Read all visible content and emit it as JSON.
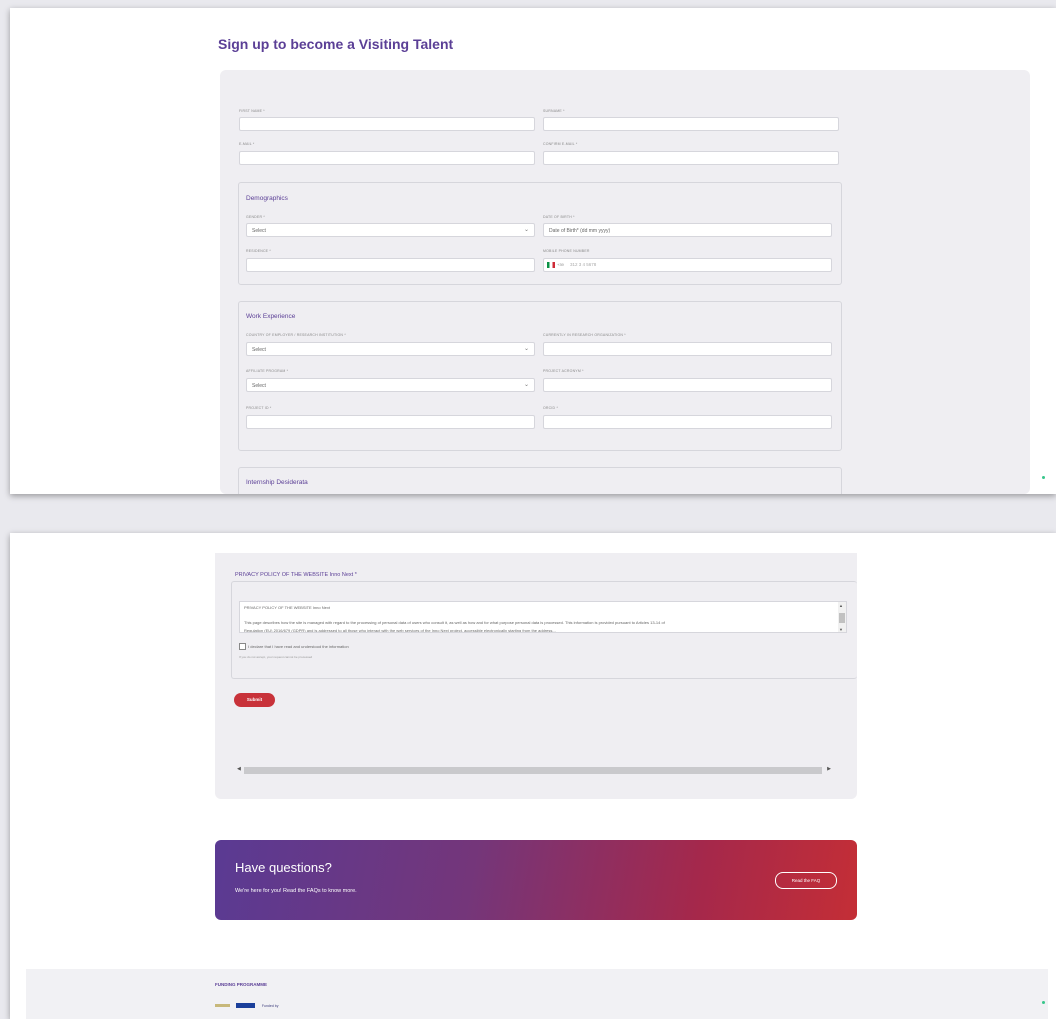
{
  "form": {
    "title": "Sign up to become a Visiting Talent",
    "fields": {
      "first_name": "FIRST NAME *",
      "surname": "SURNAME *",
      "email": "E-MAIL *",
      "confirm_email": "CONFIRM E-MAIL *"
    },
    "demographics": {
      "title": "Demographics",
      "gender_label": "GENDER *",
      "gender_value": "Select",
      "dob_label": "DATE OF BIRTH *",
      "dob_placeholder": "Date of Birth* (dd mm yyyy)",
      "residence_label": "RESIDENCE *",
      "phone_label": "MOBILE PHONE NUMBER",
      "phone_code": "+39",
      "phone_placeholder": "312 3 4 5678"
    },
    "work": {
      "title": "Work Experience",
      "country_label": "COUNTRY OF EMPLOYER / RESEARCH INSTITUTION *",
      "country_value": "Select",
      "org_label": "CURRENTLY IN RESEARCH ORGANIZATION *",
      "affiliate_label": "AFFILIATE PROGRAM *",
      "affiliate_value": "Select",
      "project_label": "PROJECT ACRONYM *",
      "project_id_label": "PROJECT ID *",
      "orcid_label": "ORCID *"
    },
    "internship": {
      "title": "Internship Desiderata"
    }
  },
  "privacy": {
    "title": "PRIVACY POLICY OF THE WEBSITE Inno Next *",
    "box_title": "PRIVACY POLICY OF THE WEBSITE Inno Next",
    "text_line1": "This page describes how the site is managed with regard to the processing of personal data of users who consult it, as well as how and for what purpose personal data is processed. This information is provided pursuant to Articles 13-14 of",
    "text_line2": "Regulation (EU) 2016/679 (GDPR) and is addressed to all those who interact with the web services of the Inno Next project, accessible electronically starting from the address...",
    "checkbox_label": "I declare that I have read and understood the information",
    "note": "If you do not accept, your request cannot be processed"
  },
  "submit_label": "Submit",
  "banner": {
    "heading": "Have questions?",
    "subtext": "We're here for you! Read the FAQs to know more.",
    "button_label": "Read the FAQ"
  },
  "footer": {
    "funding_label": "FUNDING PROGRAMME",
    "logo_text": "Funded by"
  },
  "colors": {
    "accent": "#5b3f96",
    "submit": "#c8323a",
    "banner_start": "#5a3a93",
    "banner_end": "#c42e36"
  }
}
